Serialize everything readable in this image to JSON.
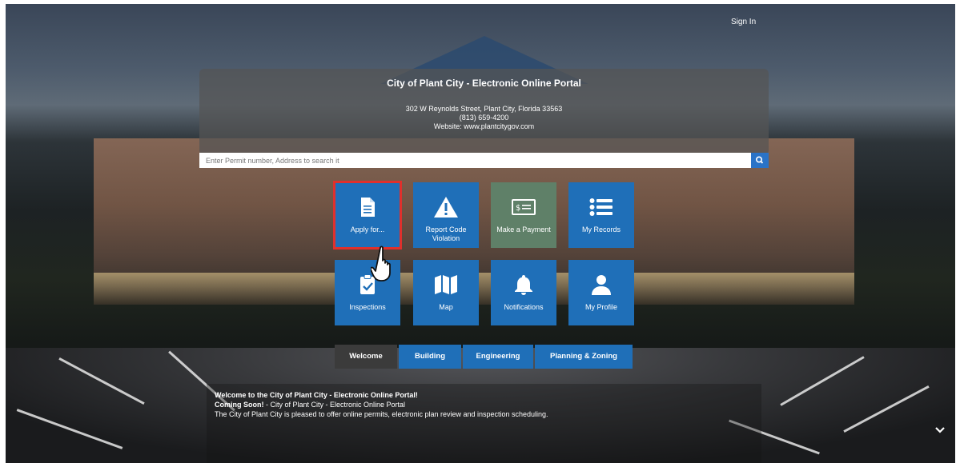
{
  "header": {
    "sign_in": "Sign In"
  },
  "portal": {
    "title": "City of Plant City - Electronic Online Portal",
    "address": "302 W Reynolds Street, Plant City, Florida 33563",
    "phone": "(813) 659-4200",
    "website": "Website: www.plantcitygov.com"
  },
  "search": {
    "placeholder": "Enter Permit number, Address to search it",
    "icon": "search-icon"
  },
  "tiles": [
    {
      "label": "Apply for...",
      "icon": "document-icon",
      "selected": true
    },
    {
      "label": "Report Code Violation",
      "icon": "warning-icon"
    },
    {
      "label": "Make a Payment",
      "icon": "money-icon"
    },
    {
      "label": "My Records",
      "icon": "list-icon"
    },
    {
      "label": "Inspections",
      "icon": "clipboard-check-icon"
    },
    {
      "label": "Map",
      "icon": "map-icon"
    },
    {
      "label": "Notifications",
      "icon": "bell-icon"
    },
    {
      "label": "My Profile",
      "icon": "user-icon"
    }
  ],
  "tabs": [
    {
      "label": "Welcome",
      "active": true
    },
    {
      "label": "Building"
    },
    {
      "label": "Engineering"
    },
    {
      "label": "Planning & Zoning"
    }
  ],
  "welcome": {
    "heading": "Welcome to the City of Plant City - Electronic Online Portal!",
    "coming_soon_label": "Coming Soon!",
    "coming_soon_text": " - City of Plant City - Electronic Online Portal",
    "body": "The City of Plant City is pleased to offer online permits, electronic plan review and inspection scheduling."
  },
  "colors": {
    "tile_blue": "#1f6fb8",
    "tile_green": "#5f8068",
    "tab_active": "#3b3b3b",
    "highlight": "#e0302c"
  }
}
